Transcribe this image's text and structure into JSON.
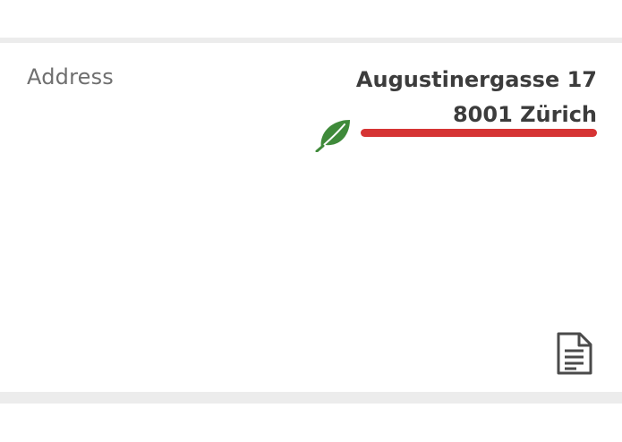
{
  "address": {
    "label": "Address",
    "street": "Augustinergasse 17",
    "city": "8001 Zürich"
  },
  "icons": {
    "leaf": "leaf-icon",
    "document": "document-icon"
  },
  "colors": {
    "accent_underline": "#d63434",
    "leaf_green": "#3f8a3a",
    "divider": "#ececec",
    "label_text": "#6f6f6f",
    "value_text": "#3c3c3c"
  }
}
